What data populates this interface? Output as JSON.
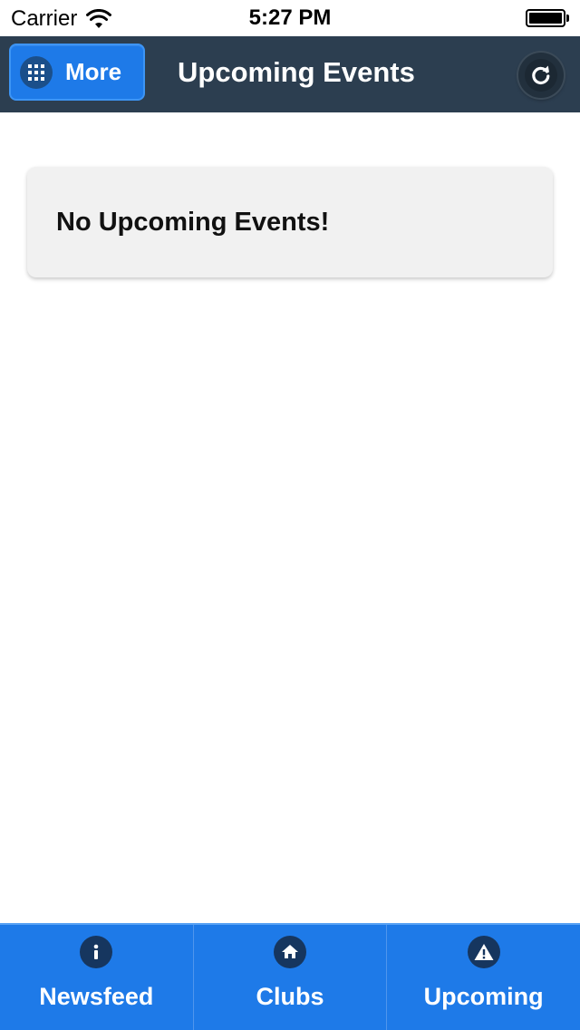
{
  "status_bar": {
    "carrier": "Carrier",
    "time": "5:27 PM",
    "icons": [
      "wifi-icon",
      "battery-icon"
    ]
  },
  "nav_bar": {
    "more_label": "More",
    "more_icon": "grid-icon",
    "title": "Upcoming Events",
    "refresh_icon": "refresh-icon",
    "background_color": "#2c3e50",
    "button_color": "#1e7ae8"
  },
  "content": {
    "empty_message": "No Upcoming Events!"
  },
  "tab_bar": {
    "background_color": "#1e7ae8",
    "tabs": [
      {
        "label": "Newsfeed",
        "icon": "info-icon"
      },
      {
        "label": "Clubs",
        "icon": "home-icon"
      },
      {
        "label": "Upcoming",
        "icon": "alert-icon"
      }
    ]
  }
}
